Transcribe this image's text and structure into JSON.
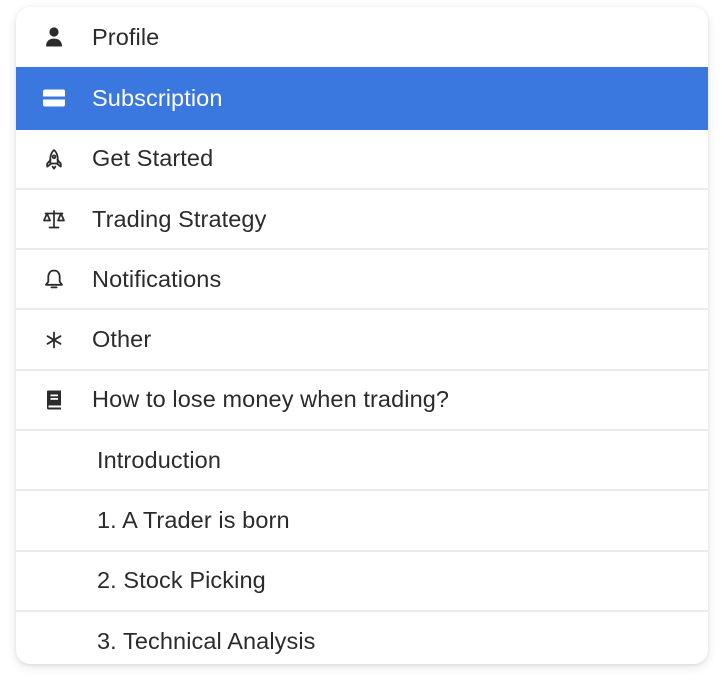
{
  "menu": {
    "items": [
      {
        "label": "Profile",
        "icon": "person-icon"
      },
      {
        "label": "Subscription",
        "icon": "credit-card-icon",
        "active": true
      },
      {
        "label": "Get Started",
        "icon": "rocket-icon"
      },
      {
        "label": "Trading Strategy",
        "icon": "scale-icon"
      },
      {
        "label": "Notifications",
        "icon": "bell-icon"
      },
      {
        "label": "Other",
        "icon": "asterisk-icon"
      },
      {
        "label": "How to lose money when trading?",
        "icon": "book-icon"
      },
      {
        "label": "Introduction"
      },
      {
        "label": "1. A Trader is born"
      },
      {
        "label": "2. Stock Picking"
      },
      {
        "label": "3. Technical Analysis"
      }
    ]
  },
  "colors": {
    "active_background": "#3a78e0",
    "active_text": "#ffffff",
    "text": "#2b2b2b",
    "divider": "#ebebeb"
  }
}
